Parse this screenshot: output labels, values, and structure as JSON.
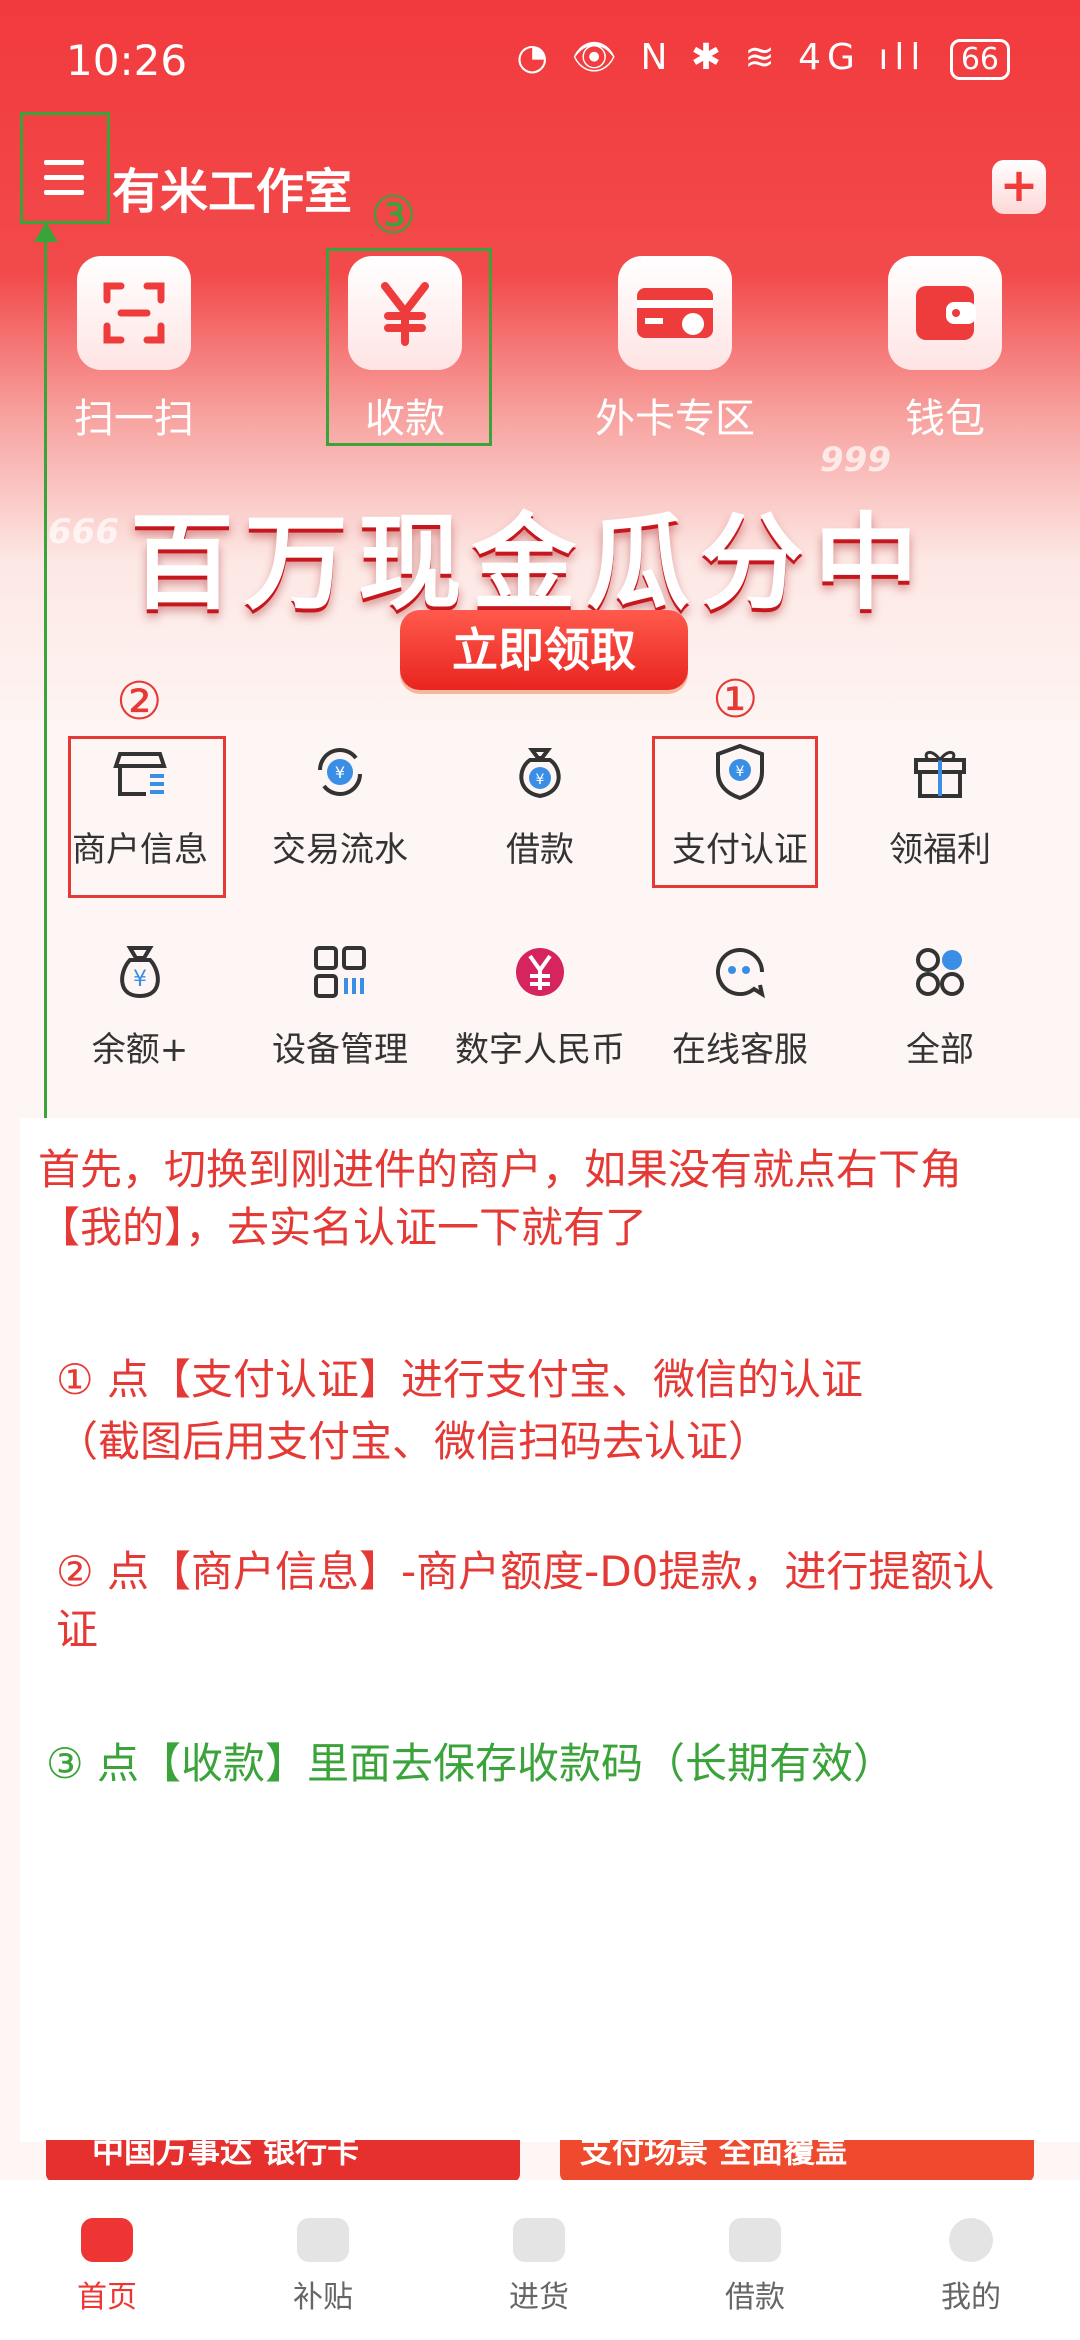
{
  "status_bar": {
    "time": "10:26",
    "icons": "◔ 👁 N ✱ ≋ 4G ıll",
    "battery": "66"
  },
  "header": {
    "store_name": "有米工作室",
    "add_label": "+"
  },
  "quick_actions": [
    {
      "label": "扫一扫",
      "icon": "scan-icon"
    },
    {
      "label": "收款",
      "icon": "yen-icon"
    },
    {
      "label": "外卡专区",
      "icon": "card-icon"
    },
    {
      "label": "钱包",
      "icon": "wallet-icon"
    }
  ],
  "banner": {
    "title": "百万现金瓜分中",
    "button": "立即领取",
    "deco_left": "666",
    "deco_right": "999"
  },
  "services_row1": [
    {
      "label": "商户信息",
      "icon": "merchant-store-icon"
    },
    {
      "label": "交易流水",
      "icon": "transaction-yen-icon"
    },
    {
      "label": "借款",
      "icon": "money-bag-icon"
    },
    {
      "label": "支付认证",
      "icon": "shield-yen-icon"
    },
    {
      "label": "领福利",
      "icon": "gift-icon"
    }
  ],
  "services_row2": [
    {
      "label": "余额+",
      "icon": "balance-bag-icon"
    },
    {
      "label": "设备管理",
      "icon": "qr-grid-icon"
    },
    {
      "label": "数字人民币",
      "icon": "digital-rmb-icon"
    },
    {
      "label": "在线客服",
      "icon": "chat-support-icon"
    },
    {
      "label": "全部",
      "icon": "all-apps-icon"
    }
  ],
  "markers": {
    "one": "①",
    "two": "②",
    "three": "③"
  },
  "instructions": {
    "intro_line1": "首先，切换到刚进件的商户，如果没有就点右下角",
    "intro_line2": "【我的】，去实名认证一下就有了",
    "step1_line1": "① 点【支付认证】进行支付宝、微信的认证",
    "step1_line2": "（截图后用支付宝、微信扫码去认证）",
    "step2_line1": "② 点【商户信息】-商户额度-D0提款，进行提额认",
    "step2_line2": "证",
    "step3": "③ 点【收款】里面去保存收款码（长期有效）"
  },
  "promos": [
    "中国万事达 银行卡",
    "支付场景 全面覆盖"
  ],
  "bottom_nav": [
    {
      "label": "首页",
      "active": true
    },
    {
      "label": "补贴",
      "active": false
    },
    {
      "label": "进货",
      "active": false
    },
    {
      "label": "借款",
      "active": false
    },
    {
      "label": "我的",
      "active": false
    }
  ],
  "colors": {
    "brand_red": "#f03b3b",
    "annotation_red": "#e53935",
    "annotation_green": "#3aa33a"
  }
}
